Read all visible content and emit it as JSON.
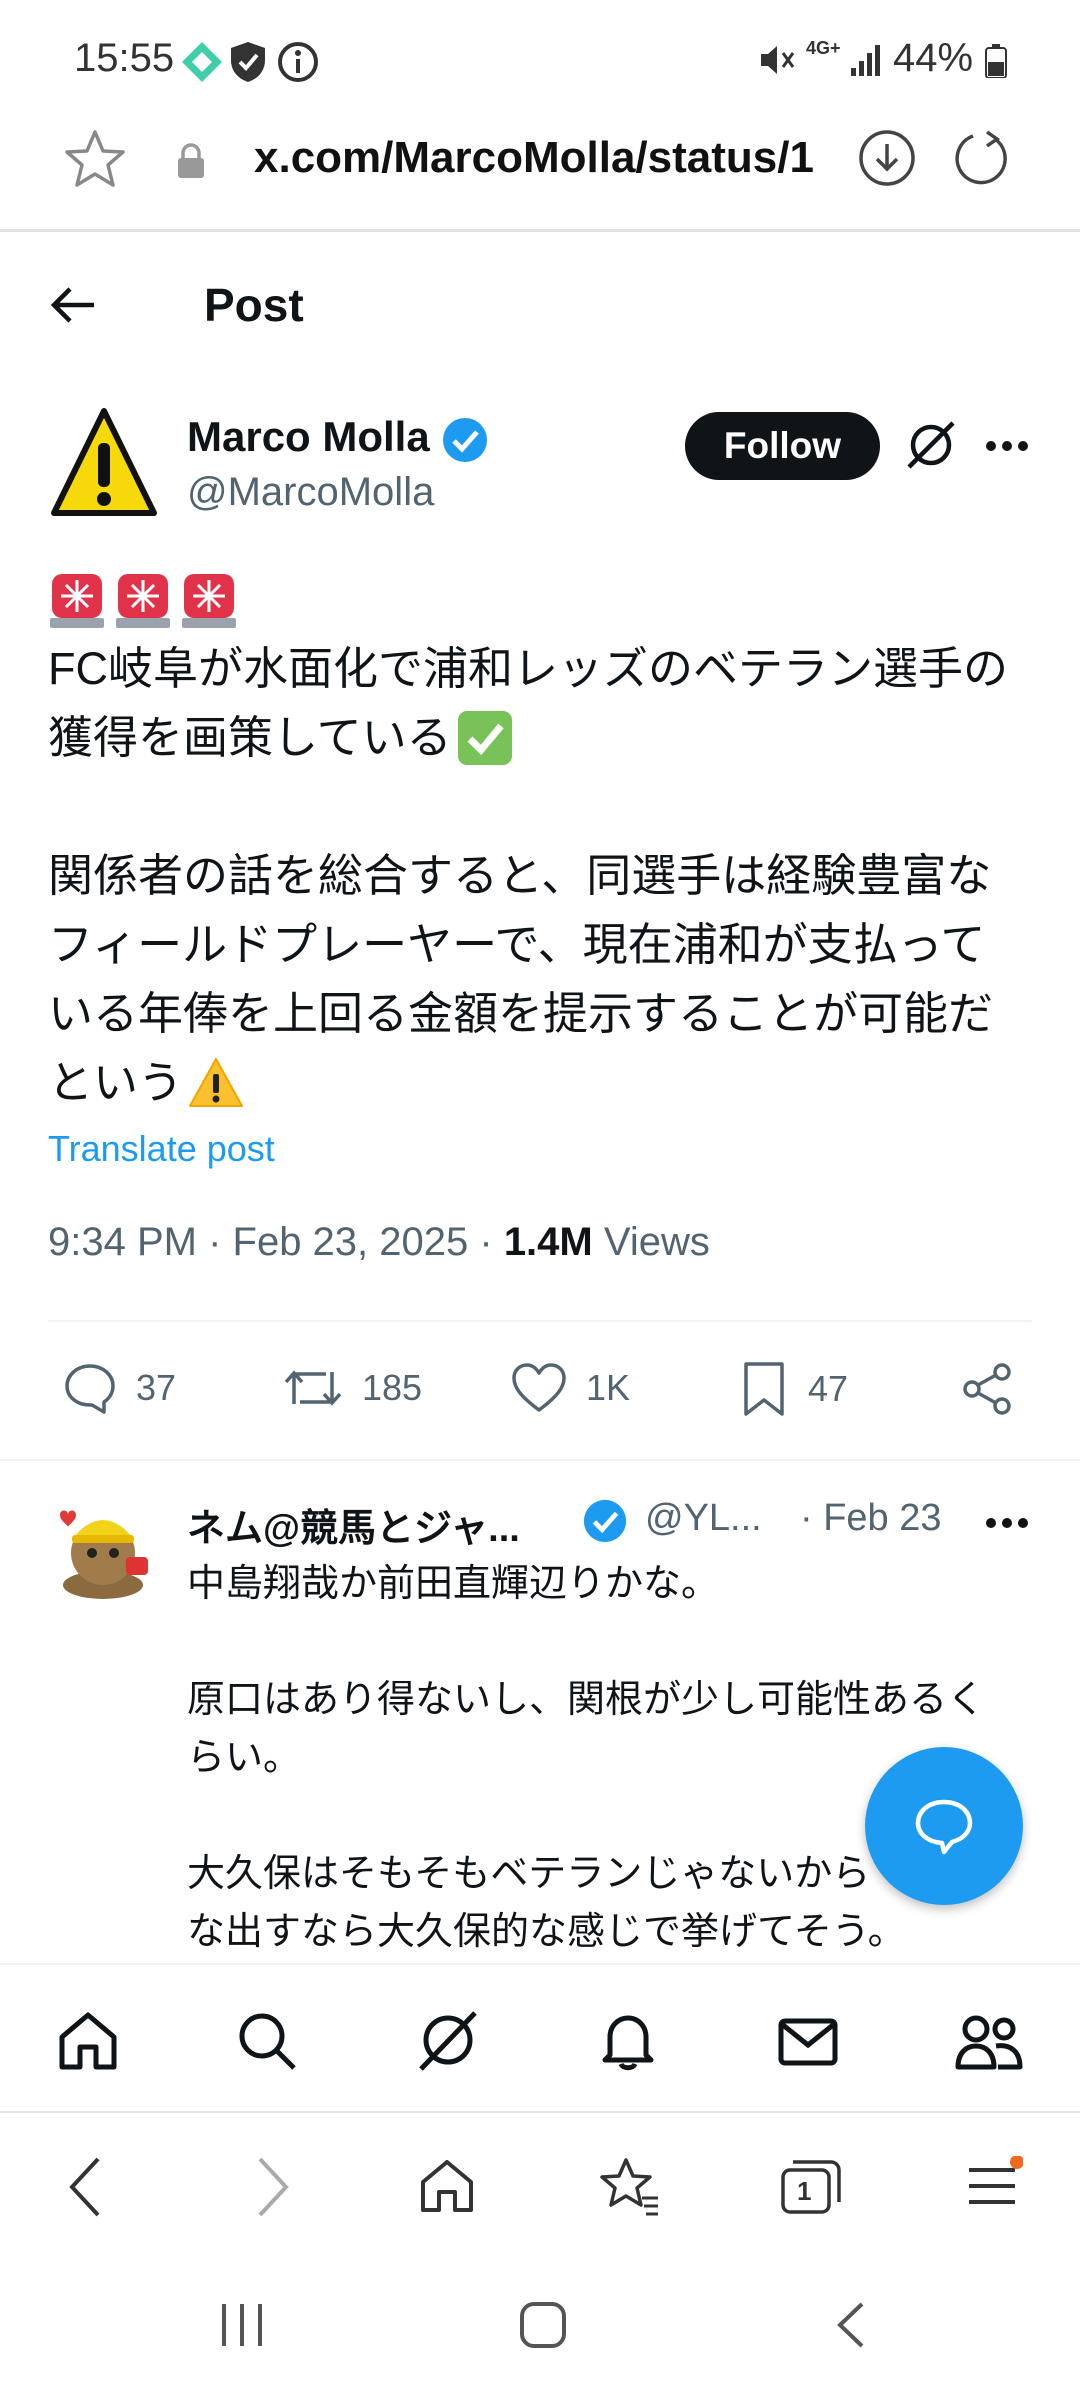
{
  "status_bar": {
    "time": "15:55",
    "network": "4G+",
    "battery": "44%"
  },
  "browser": {
    "url": "x.com/MarcoMolla/status/1",
    "tab_count": "1"
  },
  "header": {
    "title": "Post"
  },
  "post": {
    "author_name": "Marco Molla",
    "author_handle": "@MarcoMolla",
    "follow_label": "Follow",
    "text_line1": "FC岐阜が水面化で浦和レッズのベテラン選手の",
    "text_line2": "獲得を画策している",
    "text_para2_l1": "関係者の話を総合すると、同選手は経験豊富な",
    "text_para2_l2": "フィールドプレーヤーで、現在浦和が支払って",
    "text_para2_l3": "いる年俸を上回る金額を提示することが可能だ",
    "text_para2_l4": "という",
    "translate_label": "Translate post",
    "time": "9:34 PM · Feb 23, 2025 · ",
    "views_count": "1.4M",
    "views_label": " Views",
    "replies": "37",
    "reposts": "185",
    "likes": "1K",
    "bookmarks": "47"
  },
  "reply": {
    "name": "ネム@競馬とジャ...",
    "handle": "@YL...",
    "date": "· Feb 23",
    "line1": "中島翔哉か前田直輝辺りかな。",
    "line2": "原口はあり得ないし、関根が少し可能性あるく",
    "line3": "らい。",
    "line4": "大久保はそもそもベテランじゃないから　みん",
    "line5": "な出すなら大久保的な感じで挙げてそう。"
  },
  "colors": {
    "accent": "#1d9bf0",
    "text": "#0f1419",
    "muted": "#536471"
  }
}
